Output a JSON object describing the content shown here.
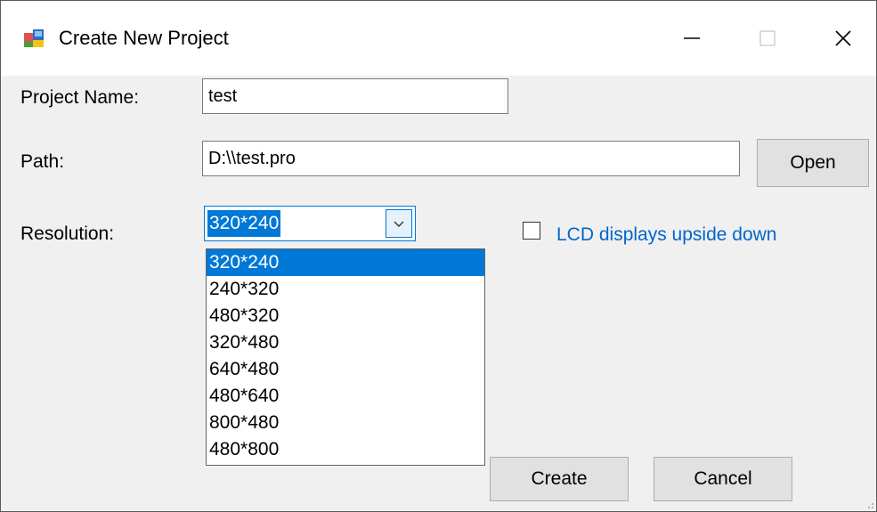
{
  "window": {
    "title": "Create New Project",
    "minimize_icon": "minimize-icon",
    "maximize_icon": "maximize-icon",
    "close_icon": "close-icon"
  },
  "form": {
    "project_name_label": "Project Name:",
    "project_name_value": "test",
    "path_label": "Path:",
    "path_value": "D:\\\\test.pro",
    "open_button": "Open",
    "resolution_label": "Resolution:",
    "resolution_selected": "320*240",
    "resolution_options": [
      "320*240",
      "240*320",
      "480*320",
      "320*480",
      "640*480",
      "480*640",
      "800*480",
      "480*800"
    ],
    "lcd_checkbox_label": "LCD displays upside down",
    "lcd_checkbox_checked": false,
    "create_button": "Create",
    "cancel_button": "Cancel"
  },
  "colors": {
    "accent": "#0078d7",
    "window_bg": "#f0f0f0",
    "link_text": "#0066cc"
  }
}
